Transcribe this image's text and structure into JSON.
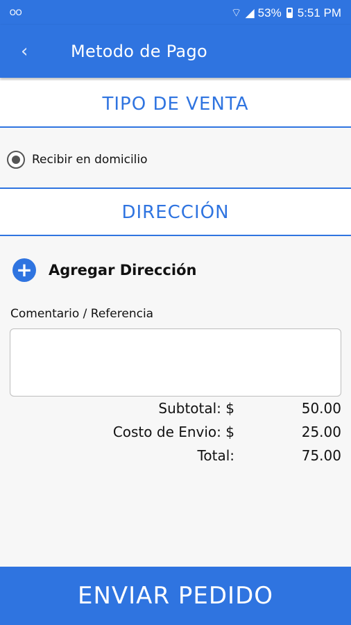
{
  "status_bar": {
    "voicemail_icon": "voicemail-icon",
    "wifi_icon": "wifi-icon",
    "signal_icon": "signal-icon",
    "battery_percent": "53%",
    "battery_icon": "battery-icon",
    "time": "5:51 PM"
  },
  "app_bar": {
    "back_icon": "chevron-left-icon",
    "title": "Metodo de Pago"
  },
  "sale_type": {
    "header": "TIPO DE VENTA",
    "option_label": "Recibir en domicilio",
    "option_selected": true
  },
  "address": {
    "header": "DIRECCIÓN",
    "add_label": "Agregar Dirección",
    "add_icon": "plus-circle-icon"
  },
  "comment": {
    "label": "Comentario / Referencia",
    "value": "",
    "placeholder": ""
  },
  "totals": {
    "subtotal_label": "Subtotal: $",
    "subtotal_value": "50.00",
    "shipping_label": "Costo de Envio: $",
    "shipping_value": "25.00",
    "total_label": "Total:",
    "total_value": "75.00"
  },
  "submit_button": "ENVIAR PEDIDO",
  "colors": {
    "primary": "#2f74e0",
    "background": "#f7f7f7"
  }
}
